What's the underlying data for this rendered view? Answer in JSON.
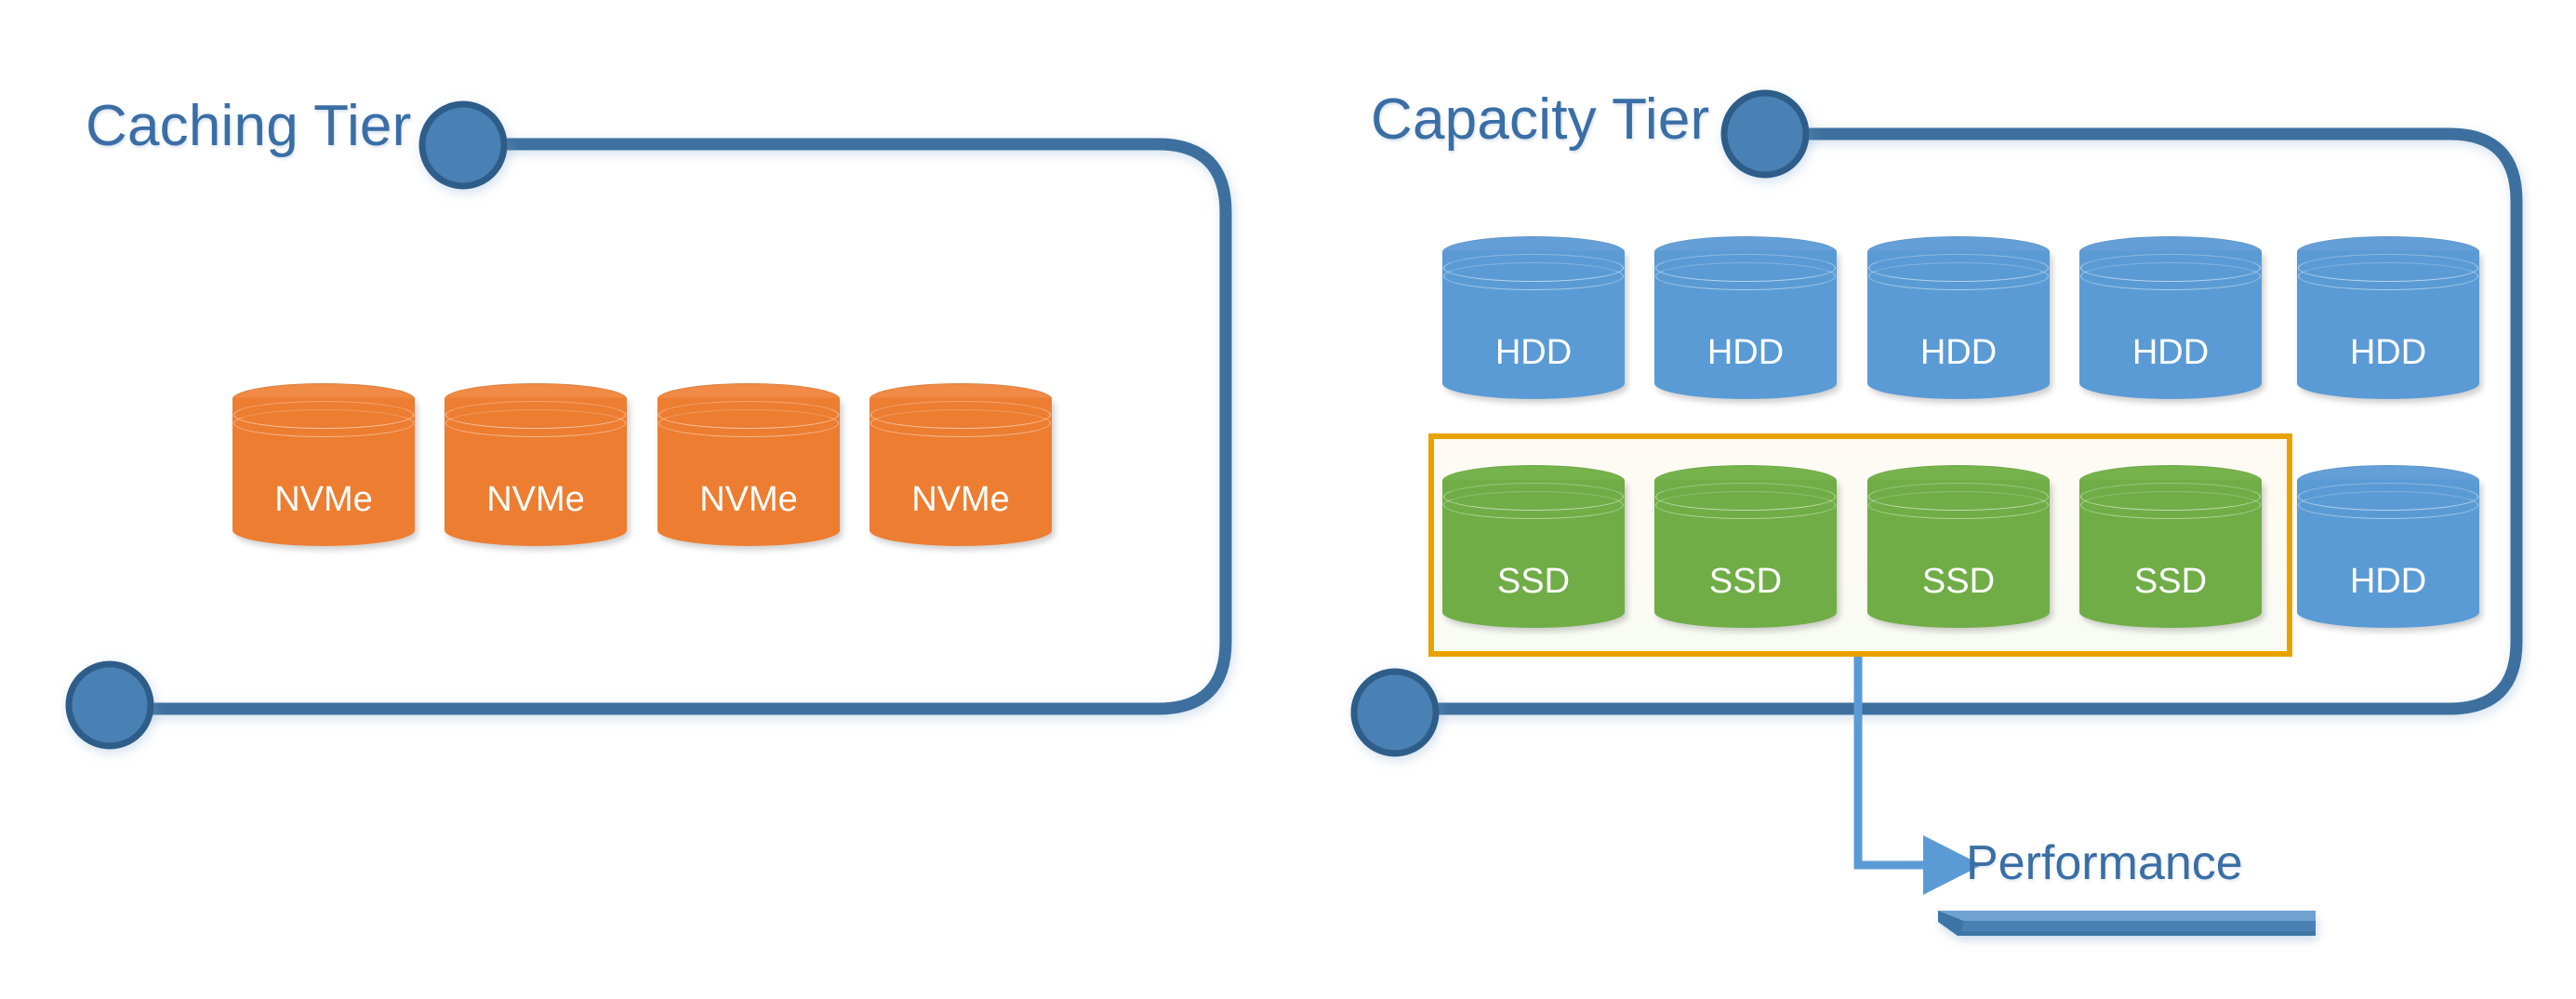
{
  "diagram": {
    "title_hidden": "",
    "tiers": [
      {
        "id": "caching",
        "label": "Caching Tier",
        "bracket_color": "#3d6f9e",
        "drives": [
          {
            "label": "NVMe",
            "type": "nvme"
          },
          {
            "label": "NVMe",
            "type": "nvme"
          },
          {
            "label": "NVMe",
            "type": "nvme"
          },
          {
            "label": "NVMe",
            "type": "nvme"
          }
        ]
      },
      {
        "id": "capacity",
        "label": "Capacity Tier",
        "bracket_color": "#3d6f9e",
        "row_top": [
          {
            "label": "HDD",
            "type": "hdd"
          },
          {
            "label": "HDD",
            "type": "hdd"
          },
          {
            "label": "HDD",
            "type": "hdd"
          },
          {
            "label": "HDD",
            "type": "hdd"
          },
          {
            "label": "HDD",
            "type": "hdd"
          }
        ],
        "row_bottom": [
          {
            "label": "SSD",
            "type": "ssd"
          },
          {
            "label": "SSD",
            "type": "ssd"
          },
          {
            "label": "SSD",
            "type": "ssd"
          },
          {
            "label": "SSD",
            "type": "ssd"
          },
          {
            "label": "HDD",
            "type": "hdd"
          }
        ]
      }
    ],
    "highlight": {
      "name": "ssd-group-highlight",
      "border_color": "#E8A200"
    },
    "callout": {
      "label": "Performance",
      "arrow_color": "#5B9BD5",
      "rule_color": "#3a6ea5",
      "bar_color": "#4A81B4"
    },
    "colors": {
      "nvme": "#ED7D31",
      "hdd": "#5B9BD5",
      "ssd": "#70AD47",
      "tier_text": "#3a6ea5",
      "bracket": "#3d6f9e",
      "node_fill": "#4A81B4",
      "node_stroke": "#2E5D8A",
      "background": "#FFFFFF"
    }
  }
}
